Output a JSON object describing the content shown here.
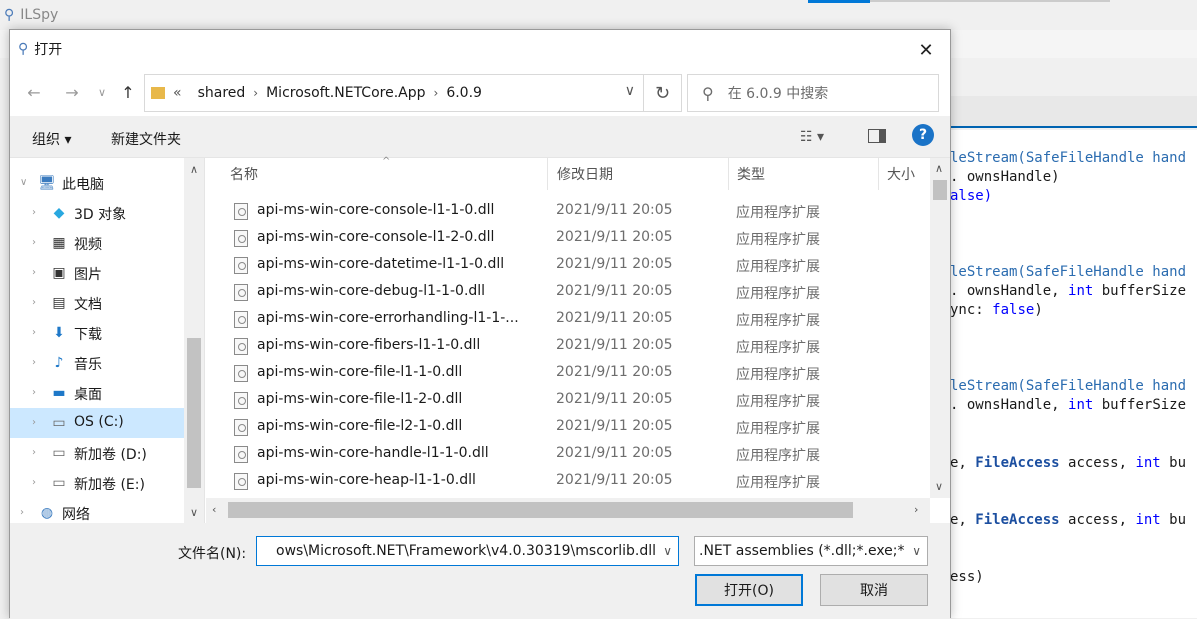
{
  "background_app": {
    "title": "ILSpy",
    "code_lines": [
      {
        "parts": [
          {
            "t": "leStream(",
            "c": "ty"
          },
          {
            "t": "SafeFileHandle",
            "c": "ty"
          },
          {
            "t": " hand",
            "c": "ty"
          }
        ]
      },
      {
        "parts": [
          {
            "t": ". ownsHandle)",
            "c": ""
          }
        ]
      },
      {
        "parts": [
          {
            "t": "alse)",
            "c": "kw"
          }
        ]
      },
      {
        "parts": [
          {
            "t": "leStream(",
            "c": "ty"
          },
          {
            "t": "SafeFileHandle",
            "c": "ty"
          },
          {
            "t": " hand",
            "c": "ty"
          }
        ]
      },
      {
        "parts": [
          {
            "t": ". ownsHandle, ",
            "c": ""
          },
          {
            "t": "int",
            "c": "kw"
          },
          {
            "t": " bufferSize",
            "c": ""
          }
        ]
      },
      {
        "parts": [
          {
            "t": "ync: ",
            "c": ""
          },
          {
            "t": "false",
            "c": "kw"
          },
          {
            "t": ")",
            "c": ""
          }
        ]
      },
      {
        "parts": [
          {
            "t": "leStream(",
            "c": "ty"
          },
          {
            "t": "SafeFileHandle",
            "c": "ty"
          },
          {
            "t": " hand",
            "c": "ty"
          }
        ]
      },
      {
        "parts": [
          {
            "t": ". ownsHandle, ",
            "c": ""
          },
          {
            "t": "int",
            "c": "kw"
          },
          {
            "t": " bufferSize",
            "c": ""
          }
        ]
      },
      {
        "parts": [
          {
            "t": "e, ",
            "c": ""
          },
          {
            "t": "FileAccess",
            "c": "ty2"
          },
          {
            "t": " access, ",
            "c": ""
          },
          {
            "t": "int",
            "c": "kw"
          },
          {
            "t": " bu",
            "c": ""
          }
        ]
      },
      {
        "parts": [
          {
            "t": "e, ",
            "c": ""
          },
          {
            "t": "FileAccess",
            "c": "ty2"
          },
          {
            "t": " access, ",
            "c": ""
          },
          {
            "t": "int",
            "c": "kw"
          },
          {
            "t": " bu",
            "c": ""
          }
        ]
      },
      {
        "parts": [
          {
            "t": "ess)",
            "c": ""
          }
        ]
      }
    ]
  },
  "dialog": {
    "title": "打开",
    "close_glyph": "✕",
    "address": {
      "overflow": "«",
      "segments": [
        "shared",
        "Microsoft.NETCore.App",
        "6.0.9"
      ]
    },
    "search_placeholder": "在 6.0.9 中搜索",
    "toolbar": {
      "organize": "组织 ▾",
      "new_folder": "新建文件夹"
    },
    "tree": [
      {
        "label": "此电脑",
        "icon": "computer-icon",
        "level": 0,
        "expanded": true
      },
      {
        "label": "3D 对象",
        "icon": "3d-objects-icon",
        "level": 1
      },
      {
        "label": "视频",
        "icon": "video-icon",
        "level": 1
      },
      {
        "label": "图片",
        "icon": "pictures-icon",
        "level": 1
      },
      {
        "label": "文档",
        "icon": "documents-icon",
        "level": 1
      },
      {
        "label": "下载",
        "icon": "downloads-icon",
        "level": 1
      },
      {
        "label": "音乐",
        "icon": "music-icon",
        "level": 1
      },
      {
        "label": "桌面",
        "icon": "desktop-icon",
        "level": 1
      },
      {
        "label": "OS (C:)",
        "icon": "drive-os-icon",
        "level": 1,
        "selected": true
      },
      {
        "label": "新加卷 (D:)",
        "icon": "drive-icon",
        "level": 1
      },
      {
        "label": "新加卷 (E:)",
        "icon": "drive-icon",
        "level": 1
      },
      {
        "label": "网络",
        "icon": "network-icon",
        "level": 0
      }
    ],
    "columns": [
      "名称",
      "修改日期",
      "类型",
      "大小"
    ],
    "files": [
      {
        "name": "api-ms-win-core-console-l1-1-0.dll",
        "date": "2021/9/11 20:05",
        "type": "应用程序扩展"
      },
      {
        "name": "api-ms-win-core-console-l1-2-0.dll",
        "date": "2021/9/11 20:05",
        "type": "应用程序扩展"
      },
      {
        "name": "api-ms-win-core-datetime-l1-1-0.dll",
        "date": "2021/9/11 20:05",
        "type": "应用程序扩展"
      },
      {
        "name": "api-ms-win-core-debug-l1-1-0.dll",
        "date": "2021/9/11 20:05",
        "type": "应用程序扩展"
      },
      {
        "name": "api-ms-win-core-errorhandling-l1-1-...",
        "date": "2021/9/11 20:05",
        "type": "应用程序扩展"
      },
      {
        "name": "api-ms-win-core-fibers-l1-1-0.dll",
        "date": "2021/9/11 20:05",
        "type": "应用程序扩展"
      },
      {
        "name": "api-ms-win-core-file-l1-1-0.dll",
        "date": "2021/9/11 20:05",
        "type": "应用程序扩展"
      },
      {
        "name": "api-ms-win-core-file-l1-2-0.dll",
        "date": "2021/9/11 20:05",
        "type": "应用程序扩展"
      },
      {
        "name": "api-ms-win-core-file-l2-1-0.dll",
        "date": "2021/9/11 20:05",
        "type": "应用程序扩展"
      },
      {
        "name": "api-ms-win-core-handle-l1-1-0.dll",
        "date": "2021/9/11 20:05",
        "type": "应用程序扩展"
      },
      {
        "name": "api-ms-win-core-heap-l1-1-0.dll",
        "date": "2021/9/11 20:05",
        "type": "应用程序扩展"
      }
    ],
    "filename_label": "文件名(N):",
    "filename_value": "ows\\Microsoft.NET\\Framework\\v4.0.30319\\mscorlib.dll",
    "filter_value": ".NET assemblies (*.dll;*.exe;*",
    "open_button": "打开(O)",
    "cancel_button": "取消",
    "colors": {
      "accent": "#0078d7",
      "selection": "#cce8ff",
      "help": "#1a73c7"
    }
  }
}
